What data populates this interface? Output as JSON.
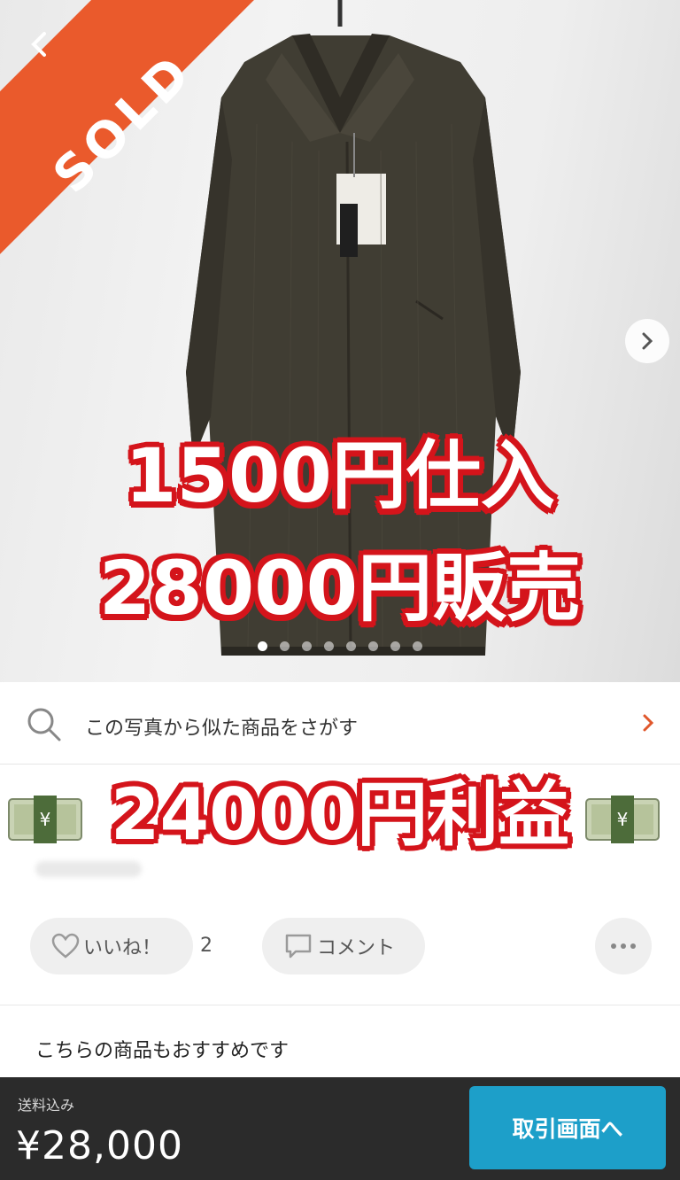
{
  "hero": {
    "sold_label": "SOLD",
    "overlay_line1": "1500円仕入",
    "overlay_line2": "28000円販売",
    "image_count": 8,
    "active_image": 1
  },
  "similar_search": {
    "label": "この写真から似た商品をさがす"
  },
  "profit_overlay": {
    "text": "24000円利益"
  },
  "actions": {
    "like_label": "いいね！",
    "like_count": "2",
    "comment_label": "コメント"
  },
  "recommend": {
    "heading": "こちらの商品もおすすめです"
  },
  "bottom_bar": {
    "shipping_label": "送料込み",
    "price": "¥28,000",
    "trade_button_label": "取引画面へ"
  },
  "colors": {
    "sold_banner": "#ea5a2c",
    "overlay_outline": "#d4141b",
    "trade_button": "#1d9fc9",
    "bottom_bar": "#2b2b2b",
    "chevron_accent": "#e0572b"
  },
  "icons": {
    "back": "chevron-left-icon",
    "next": "chevron-right-icon",
    "search": "magnifier-icon",
    "like": "heart-icon",
    "comment": "speech-bubble-icon",
    "more": "ellipsis-icon",
    "money": "money-bag-icon"
  }
}
